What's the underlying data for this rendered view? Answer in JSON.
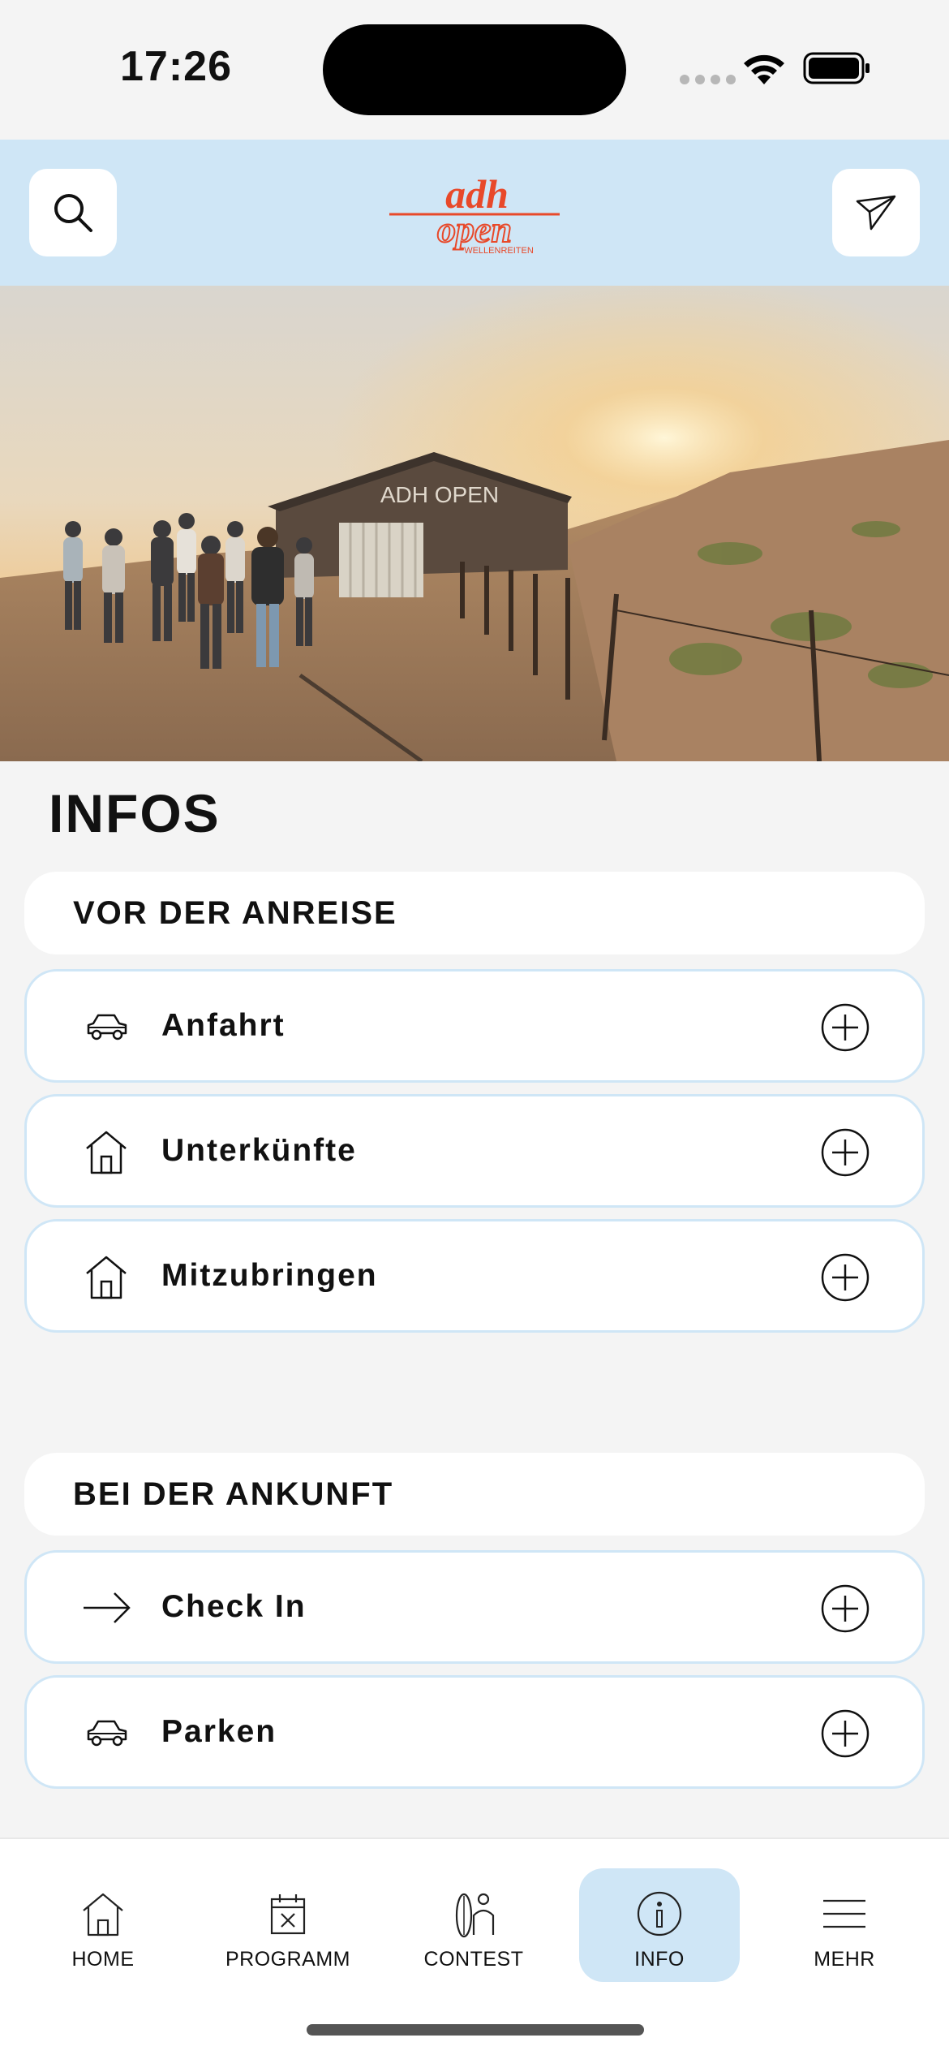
{
  "status_bar": {
    "time": "17:26"
  },
  "header": {
    "logo_text": "adh open",
    "logo_subtitle": "WELLENREITEN",
    "search_icon": "search-icon",
    "send_icon": "paper-plane-icon",
    "brand_color": "#e8492a",
    "bar_color": "#cfe6f6"
  },
  "hero": {
    "sign_text": "ADH OPEN"
  },
  "page": {
    "title": "INFOS"
  },
  "sections": [
    {
      "title": "VOR DER ANREISE",
      "items": [
        {
          "label": "Anfahrt",
          "icon": "car-icon"
        },
        {
          "label": "Unterkünfte",
          "icon": "house-icon"
        },
        {
          "label": "Mitzubringen",
          "icon": "house-icon"
        }
      ]
    },
    {
      "title": "BEI DER ANKUNFT",
      "items": [
        {
          "label": "Check In",
          "icon": "arrow-right-icon"
        },
        {
          "label": "Parken",
          "icon": "car-icon"
        }
      ]
    }
  ],
  "nav": {
    "active": "INFO",
    "items": [
      {
        "label": "HOME",
        "icon": "house-icon"
      },
      {
        "label": "PROGRAMM",
        "icon": "calendar-icon"
      },
      {
        "label": "CONTEST",
        "icon": "surfboard-person-icon"
      },
      {
        "label": "INFO",
        "icon": "info-icon"
      },
      {
        "label": "MEHR",
        "icon": "menu-icon"
      }
    ]
  }
}
